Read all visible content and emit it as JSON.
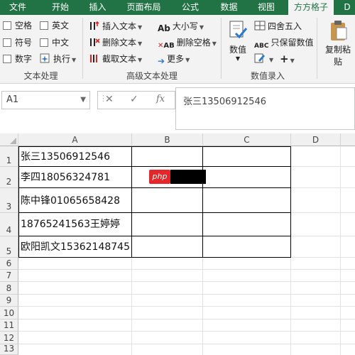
{
  "ribbon_tabs": [
    "文件",
    "开始",
    "插入",
    "页面布局",
    "公式",
    "数据",
    "视图",
    "方方格子",
    "D"
  ],
  "active_tab": "方方格子",
  "text_processing": {
    "label": "文本处理",
    "options": [
      "空格",
      "英文",
      "符号",
      "中文",
      "数字",
      "执行"
    ]
  },
  "advanced_text": {
    "label": "高级文本处理",
    "buttons": [
      "插入文本",
      "删除文本",
      "截取文本",
      "大小写",
      "删除空格",
      "更多"
    ]
  },
  "numeric_entry": {
    "label": "数值录入",
    "value_button": "数值",
    "round_button": "四舍五入",
    "keep_value_button": "只保留数值"
  },
  "paste": {
    "label": "复制粘",
    "label2": "贴"
  },
  "name_box": "A1",
  "formula_icons": {
    "cancel": "✕",
    "enter": "✓",
    "function": "fx"
  },
  "formula_value": "张三13506912546",
  "columns": [
    "A",
    "B",
    "C",
    "D"
  ],
  "rows": [
    "1",
    "2",
    "3",
    "4",
    "5",
    "6",
    "7",
    "8",
    "9",
    "10",
    "11",
    "12",
    "13"
  ],
  "cells": {
    "A1": "张三13506912546",
    "A2": "李四18056324781",
    "A3": "陈中锋01065658428",
    "A4": "18765241563王婷婷",
    "A5": "欧阳凯文15362148745"
  },
  "watermark": "php",
  "colors": {
    "excel_green": "#217346",
    "php_red": "#e5262a"
  }
}
